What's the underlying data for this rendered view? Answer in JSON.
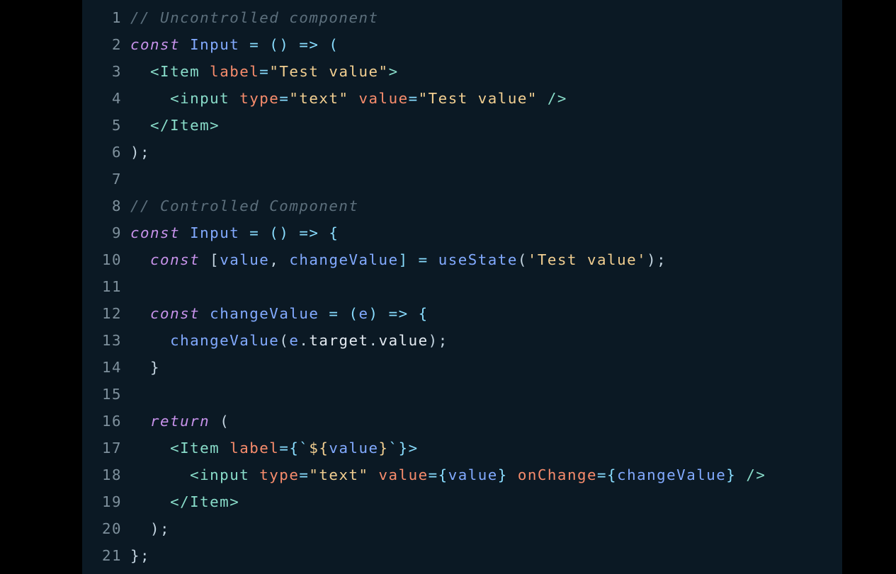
{
  "editor": {
    "lines": [
      {
        "num": "1",
        "tokens": [
          {
            "t": "// Uncontrolled component",
            "c": "comment"
          }
        ]
      },
      {
        "num": "2",
        "tokens": [
          {
            "t": "const",
            "c": "keyword"
          },
          {
            "t": " Input",
            "c": "name"
          },
          {
            "t": " = () => (",
            "c": "op"
          }
        ]
      },
      {
        "num": "3",
        "tokens": [
          {
            "t": "  <Item",
            "c": "tag"
          },
          {
            "t": " label",
            "c": "attr"
          },
          {
            "t": "=",
            "c": "op"
          },
          {
            "t": "\"Test value\"",
            "c": "string"
          },
          {
            "t": ">",
            "c": "tag"
          }
        ]
      },
      {
        "num": "4",
        "tokens": [
          {
            "t": "    <input",
            "c": "tag"
          },
          {
            "t": " type",
            "c": "attr"
          },
          {
            "t": "=",
            "c": "op"
          },
          {
            "t": "\"text\"",
            "c": "string"
          },
          {
            "t": " value",
            "c": "attr"
          },
          {
            "t": "=",
            "c": "op"
          },
          {
            "t": "\"Test value\"",
            "c": "string"
          },
          {
            "t": " />",
            "c": "tag"
          }
        ]
      },
      {
        "num": "5",
        "tokens": [
          {
            "t": "  </Item>",
            "c": "tag"
          }
        ]
      },
      {
        "num": "6",
        "tokens": [
          {
            "t": ");",
            "c": "plain"
          }
        ]
      },
      {
        "num": "7",
        "tokens": []
      },
      {
        "num": "8",
        "tokens": [
          {
            "t": "// Controlled Component",
            "c": "comment"
          }
        ]
      },
      {
        "num": "9",
        "tokens": [
          {
            "t": "const",
            "c": "keyword"
          },
          {
            "t": " Input",
            "c": "name"
          },
          {
            "t": " = () => {",
            "c": "op"
          }
        ]
      },
      {
        "num": "10",
        "tokens": [
          {
            "t": "  const",
            "c": "keyword"
          },
          {
            "t": " [",
            "c": "plain"
          },
          {
            "t": "value",
            "c": "name"
          },
          {
            "t": ", ",
            "c": "plain"
          },
          {
            "t": "changeValue",
            "c": "name"
          },
          {
            "t": "] = ",
            "c": "op"
          },
          {
            "t": "useState",
            "c": "func"
          },
          {
            "t": "(",
            "c": "plain"
          },
          {
            "t": "'Test value'",
            "c": "string"
          },
          {
            "t": ");",
            "c": "plain"
          }
        ]
      },
      {
        "num": "11",
        "tokens": []
      },
      {
        "num": "12",
        "tokens": [
          {
            "t": "  const",
            "c": "keyword"
          },
          {
            "t": " changeValue",
            "c": "name"
          },
          {
            "t": " = (",
            "c": "op"
          },
          {
            "t": "e",
            "c": "name"
          },
          {
            "t": ") => {",
            "c": "op"
          }
        ]
      },
      {
        "num": "13",
        "tokens": [
          {
            "t": "    changeValue",
            "c": "func"
          },
          {
            "t": "(",
            "c": "plain"
          },
          {
            "t": "e",
            "c": "name"
          },
          {
            "t": ".",
            "c": "plain"
          },
          {
            "t": "target",
            "c": "prop"
          },
          {
            "t": ".",
            "c": "plain"
          },
          {
            "t": "value",
            "c": "prop"
          },
          {
            "t": ");",
            "c": "plain"
          }
        ]
      },
      {
        "num": "14",
        "tokens": [
          {
            "t": "  }",
            "c": "plain"
          }
        ]
      },
      {
        "num": "15",
        "tokens": []
      },
      {
        "num": "16",
        "tokens": [
          {
            "t": "  return",
            "c": "keyword"
          },
          {
            "t": " (",
            "c": "plain"
          }
        ]
      },
      {
        "num": "17",
        "tokens": [
          {
            "t": "    <Item",
            "c": "tag"
          },
          {
            "t": " label",
            "c": "attr"
          },
          {
            "t": "={`",
            "c": "op"
          },
          {
            "t": "${",
            "c": "string"
          },
          {
            "t": "value",
            "c": "name"
          },
          {
            "t": "}",
            "c": "string"
          },
          {
            "t": "`}>",
            "c": "op"
          }
        ]
      },
      {
        "num": "18",
        "tokens": [
          {
            "t": "      <input",
            "c": "tag"
          },
          {
            "t": " type",
            "c": "attr"
          },
          {
            "t": "=",
            "c": "op"
          },
          {
            "t": "\"text\"",
            "c": "string"
          },
          {
            "t": " value",
            "c": "attr"
          },
          {
            "t": "={",
            "c": "op"
          },
          {
            "t": "value",
            "c": "name"
          },
          {
            "t": "}",
            "c": "op"
          },
          {
            "t": " onChange",
            "c": "attr"
          },
          {
            "t": "={",
            "c": "op"
          },
          {
            "t": "changeValue",
            "c": "name"
          },
          {
            "t": "}",
            "c": "op"
          },
          {
            "t": " />",
            "c": "tag"
          }
        ]
      },
      {
        "num": "19",
        "tokens": [
          {
            "t": "    </Item>",
            "c": "tag"
          }
        ]
      },
      {
        "num": "20",
        "tokens": [
          {
            "t": "  );",
            "c": "plain"
          }
        ]
      },
      {
        "num": "21",
        "tokens": [
          {
            "t": "};",
            "c": "plain"
          }
        ]
      }
    ]
  }
}
